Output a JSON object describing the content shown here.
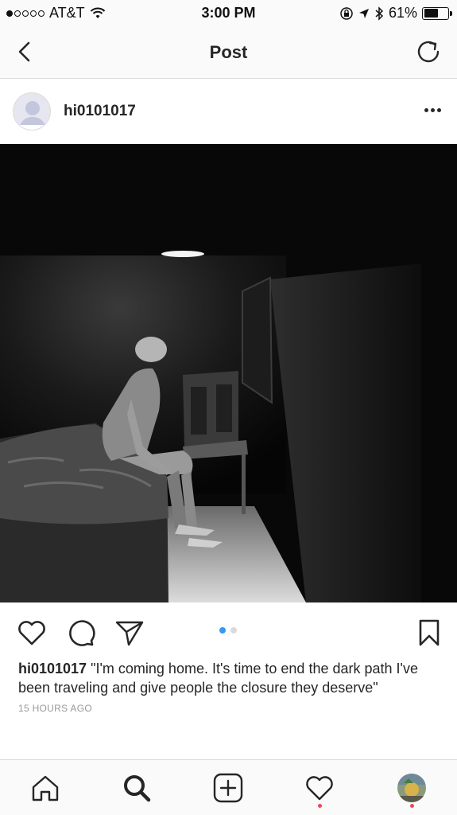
{
  "status_bar": {
    "carrier": "AT&T",
    "time": "3:00 PM",
    "battery_percent": "61%",
    "battery_level": 0.61,
    "icons": [
      "signal-dots-icon",
      "wifi-icon",
      "orientation-lock-icon",
      "location-arrow-icon",
      "bluetooth-icon",
      "battery-icon"
    ]
  },
  "header": {
    "title": "Post",
    "back_icon": "chevron-left-icon",
    "refresh_icon": "refresh-icon"
  },
  "post": {
    "username": "hi0101017",
    "more_icon": "more-horizontal-icon",
    "photo_alt": "Dark room with a seated figure on a bed under a ceiling light",
    "carousel": {
      "total": 2,
      "active": 1
    },
    "caption_username": "hi0101017",
    "caption_text": " \"I'm coming home. It's time to end the dark path I've been traveling and give people the closure they deserve\"",
    "timestamp": "15 HOURS AGO"
  },
  "actions": {
    "like_icon": "heart-icon",
    "comment_icon": "comment-icon",
    "share_icon": "send-icon",
    "save_icon": "bookmark-icon"
  },
  "tab_bar": {
    "items": [
      {
        "name": "home",
        "icon": "home-icon"
      },
      {
        "name": "search",
        "icon": "search-icon",
        "active": true
      },
      {
        "name": "new-post",
        "icon": "add-square-icon"
      },
      {
        "name": "activity",
        "icon": "heart-icon",
        "notification": true
      },
      {
        "name": "profile",
        "icon": "avatar",
        "notification": true
      }
    ]
  },
  "colors": {
    "accent": "#3897f0",
    "notification": "#ed4956",
    "text": "#262626",
    "muted": "#999999",
    "border": "#dbdbdb"
  }
}
